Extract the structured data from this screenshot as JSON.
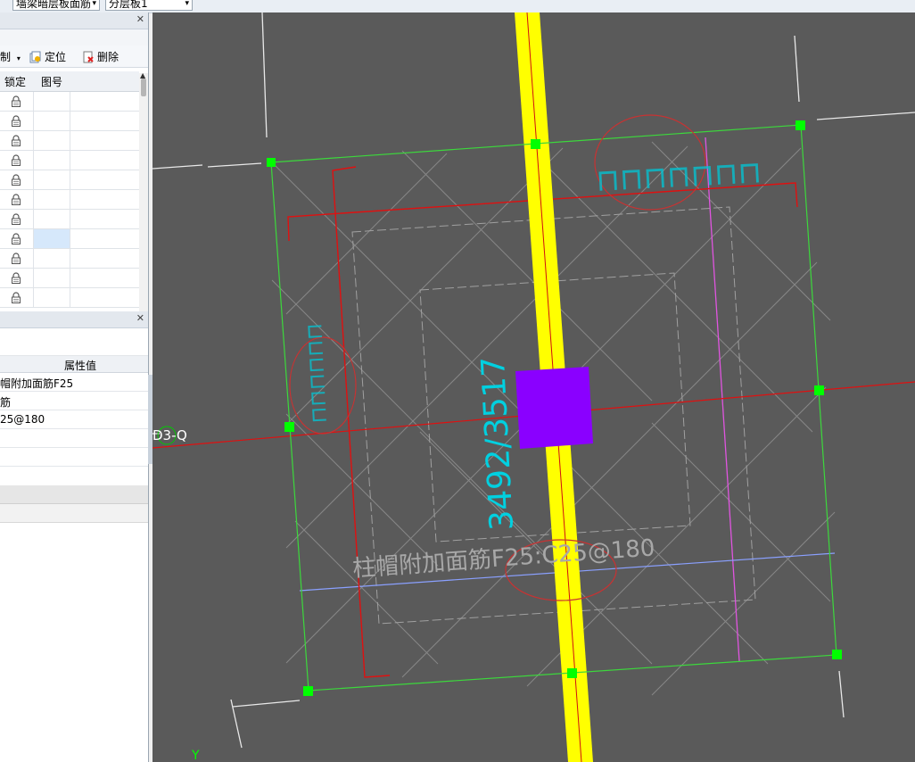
{
  "top_toolbar": {
    "combo1_value": "墙梁暗层板面筋",
    "combo2_value": "分层板1"
  },
  "layer_panel": {
    "toolbar": {
      "partial_label": "制",
      "locate_label": "定位",
      "delete_label": "删除"
    },
    "columns": [
      "锁定",
      "图号"
    ],
    "row_count": 11,
    "selected_row": 7
  },
  "property_panel": {
    "header": "属性值",
    "rows": [
      "帽附加面筋F25",
      "筋",
      "25@180",
      "",
      ""
    ]
  },
  "canvas": {
    "axis_label": "D3-Q",
    "y_axis_label": "Y",
    "rebar_label": "柱帽附加面筋F25:C25@180",
    "dimension_label": "3492/3517",
    "accent_colors": {
      "column": "#8a00ff",
      "wall": "#ffff00",
      "handle": "#00ff00",
      "axis": "#ff0000",
      "cyan_text": "#00c8d8"
    }
  }
}
